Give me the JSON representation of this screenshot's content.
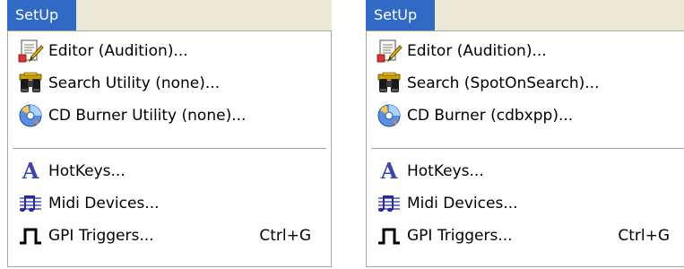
{
  "menus": [
    {
      "title": "SetUp",
      "items": [
        {
          "label": "Editor (Audition)...",
          "icon": "editor-icon",
          "shortcut": ""
        },
        {
          "label": "Search Utility (none)...",
          "icon": "binoculars-icon",
          "shortcut": ""
        },
        {
          "label": "CD Burner Utility (none)...",
          "icon": "cd-icon",
          "shortcut": ""
        },
        {
          "label": "HotKeys...",
          "icon": "hotkeys-icon",
          "shortcut": ""
        },
        {
          "label": "Midi Devices...",
          "icon": "midi-icon",
          "shortcut": ""
        },
        {
          "label": "GPI Triggers...",
          "icon": "gpi-pulse-icon",
          "shortcut": "Ctrl+G"
        }
      ]
    },
    {
      "title": "SetUp",
      "items": [
        {
          "label": "Editor (Audition)...",
          "icon": "editor-icon",
          "shortcut": ""
        },
        {
          "label": "Search (SpotOnSearch)...",
          "icon": "binoculars-icon",
          "shortcut": ""
        },
        {
          "label": "CD Burner (cdbxpp)...",
          "icon": "cd-icon",
          "shortcut": ""
        },
        {
          "label": "HotKeys...",
          "icon": "hotkeys-icon",
          "shortcut": ""
        },
        {
          "label": "Midi Devices...",
          "icon": "midi-icon",
          "shortcut": ""
        },
        {
          "label": "GPI Triggers...",
          "icon": "gpi-pulse-icon",
          "shortcut": "Ctrl+G"
        }
      ]
    }
  ],
  "colors": {
    "menu_highlight": "#316ac5",
    "menubar_bg": "#ece9d8",
    "border": "#aca899",
    "hotkey_glyph": "#3a49a8"
  },
  "hotkey_glyph_char": "A"
}
